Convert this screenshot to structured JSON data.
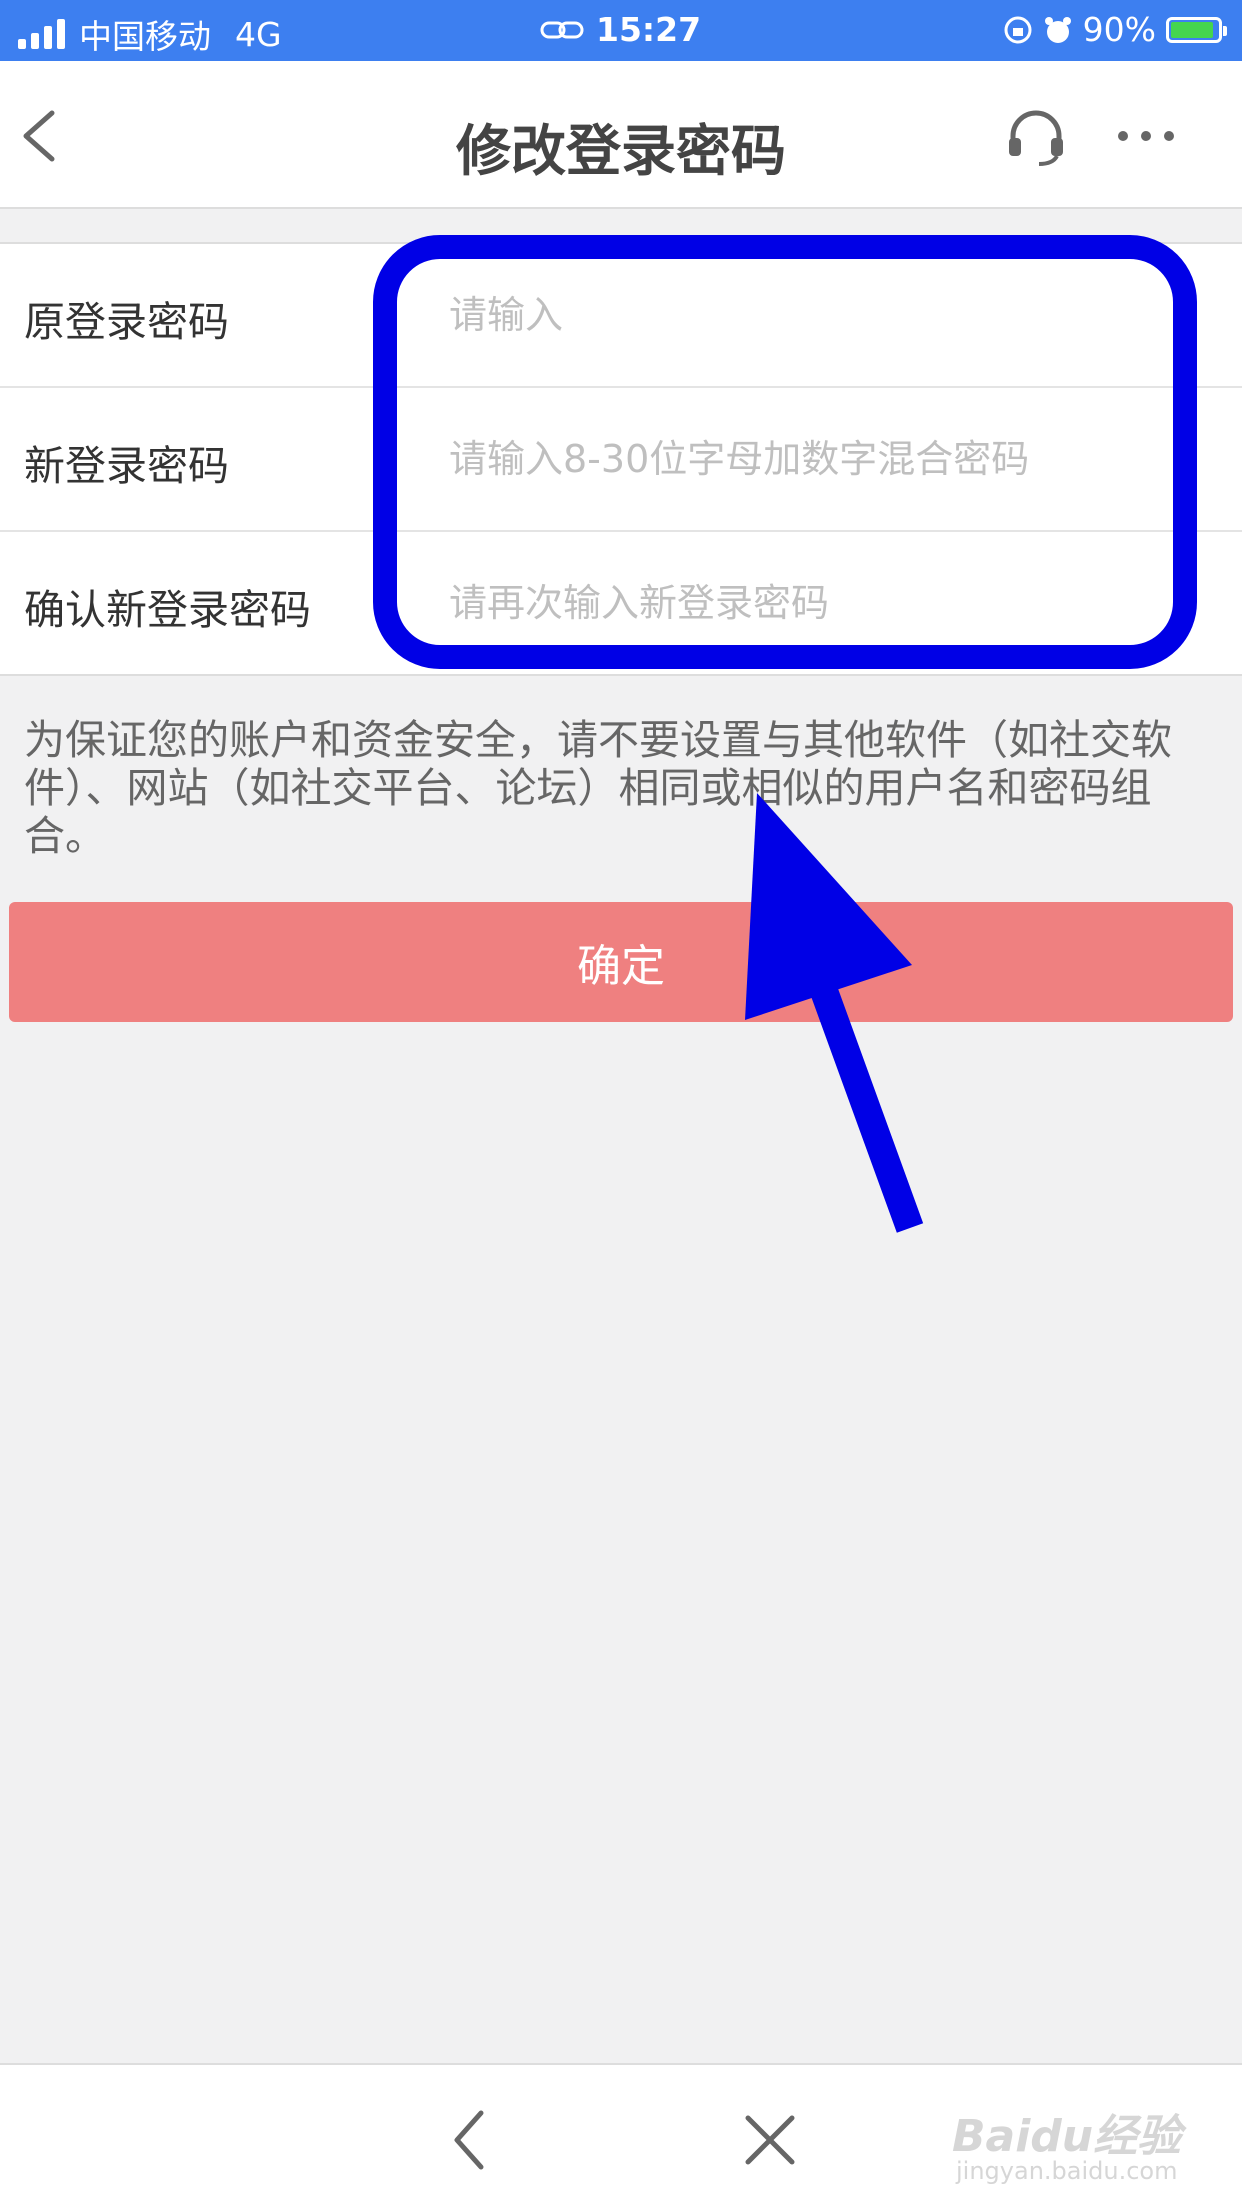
{
  "status_bar": {
    "carrier": "中国移动",
    "network": "4G",
    "time": "15:27",
    "battery": "90%",
    "battery_level": 0.9
  },
  "header": {
    "title": "修改登录密码",
    "back_icon": "chevron-left-icon",
    "support_icon": "headset-icon",
    "more_icon": "more-dots-icon"
  },
  "form": {
    "fields": [
      {
        "label": "原登录密码",
        "placeholder": "请输入",
        "value": ""
      },
      {
        "label": "新登录密码",
        "placeholder": "请输入8-30位字母加数字混合密码",
        "value": ""
      },
      {
        "label": "确认新登录密码",
        "placeholder": "请再次输入新登录密码",
        "value": ""
      }
    ]
  },
  "tip": "为保证您的账户和资金安全，请不要设置与其他软件（如社交软件）、网站（如社交平台、论坛）相同或相似的用户名和密码组合。",
  "confirm_label": "确定",
  "colors": {
    "status_bar": "#3d7ff0",
    "confirm_button": "#ef8080",
    "annotation": "#0000e6"
  },
  "bottom_bar": {
    "back_icon": "chevron-left-icon",
    "close_icon": "close-icon",
    "watermark": "Baidu经验",
    "watermark_sub": "jingyan.baidu.com"
  }
}
